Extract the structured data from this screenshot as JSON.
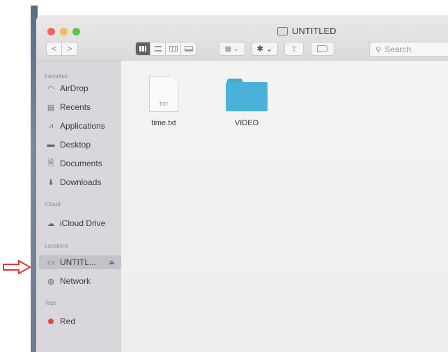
{
  "window": {
    "title": "UNTITLED"
  },
  "toolbar": {
    "back": "<",
    "forward": ">",
    "search_placeholder": "Search"
  },
  "sidebar": {
    "favorites_heading": "Favorites",
    "favorites": [
      {
        "label": "AirDrop",
        "icon": "airdrop-icon"
      },
      {
        "label": "Recents",
        "icon": "recents-icon"
      },
      {
        "label": "Applications",
        "icon": "applications-icon"
      },
      {
        "label": "Desktop",
        "icon": "desktop-icon"
      },
      {
        "label": "Documents",
        "icon": "documents-icon"
      },
      {
        "label": "Downloads",
        "icon": "downloads-icon"
      }
    ],
    "icloud_heading": "iCloud",
    "icloud": [
      {
        "label": "iCloud Drive",
        "icon": "cloud-icon"
      }
    ],
    "locations_heading": "Locations",
    "locations": [
      {
        "label": "UNTITL...",
        "icon": "disk-icon",
        "selected": true,
        "eject": "⏏"
      },
      {
        "label": "Network",
        "icon": "network-icon"
      }
    ],
    "tags_heading": "Tags",
    "tags": [
      {
        "label": "Red",
        "color": "#e0463e"
      }
    ]
  },
  "files": [
    {
      "name": "time.txt",
      "type": "document",
      "ext": "TXT"
    },
    {
      "name": "VIDEO",
      "type": "folder"
    }
  ],
  "colors": {
    "annotation_arrow": "#e8332f",
    "folder": "#4ab2d8"
  }
}
